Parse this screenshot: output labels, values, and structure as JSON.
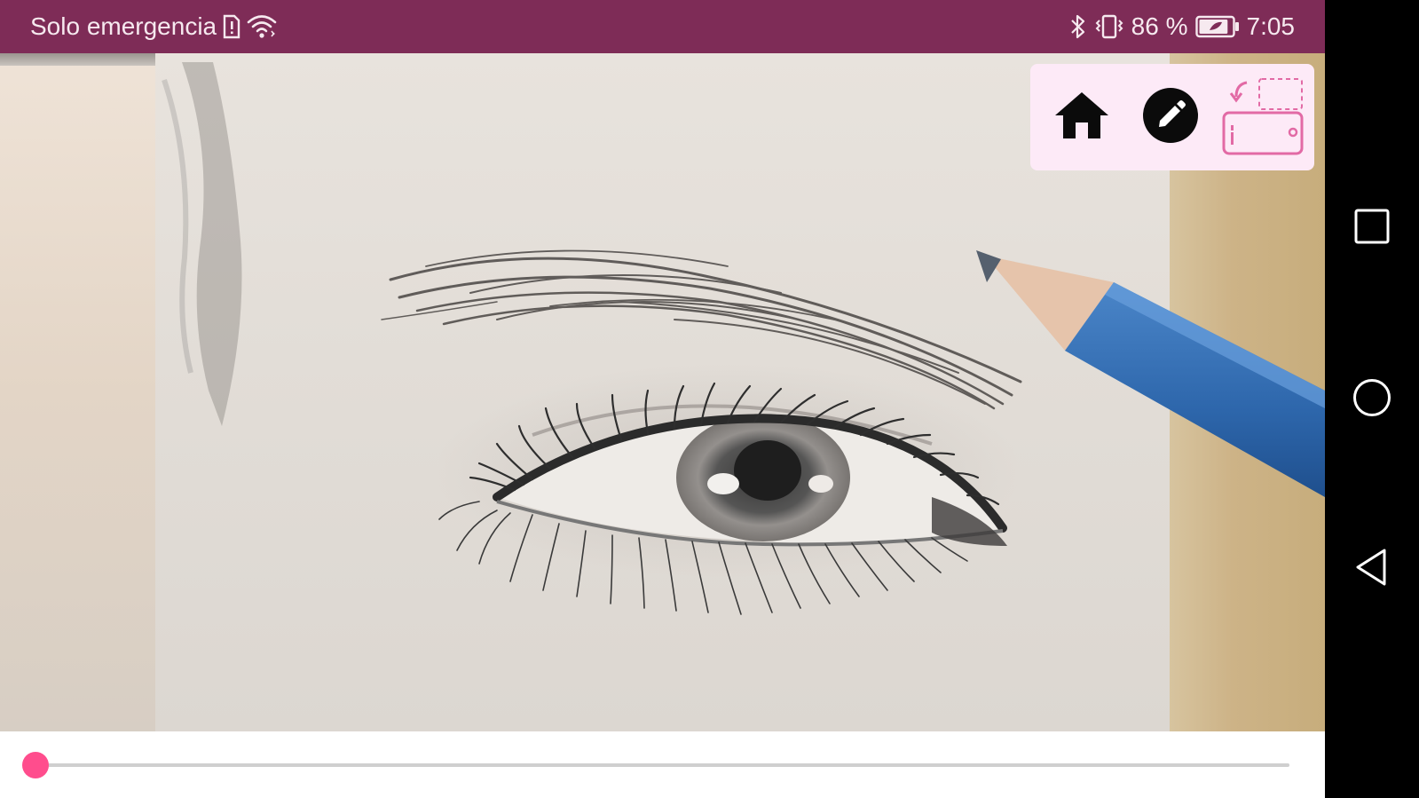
{
  "status_bar": {
    "carrier": "Solo emergencia",
    "battery_percent": "86 %",
    "time": "7:05",
    "battery_level": 0.86,
    "icons": [
      "sim-alert-icon",
      "wifi-icon",
      "bluetooth-icon",
      "vibrate-icon",
      "battery-icon"
    ],
    "background_color": "#7e2c57"
  },
  "toolbar": {
    "home_icon": "home-icon",
    "edit_icon": "pencil-icon",
    "rotate_icon": "rotate-screen-icon",
    "background_color": "#fdeaf7",
    "accent_color": "#e26aa5"
  },
  "seekbar": {
    "progress": 0.0,
    "accent_color": "#ff4d8d"
  },
  "nav_bar": {
    "icons": [
      "recents-icon",
      "home-circle-icon",
      "back-icon"
    ]
  }
}
